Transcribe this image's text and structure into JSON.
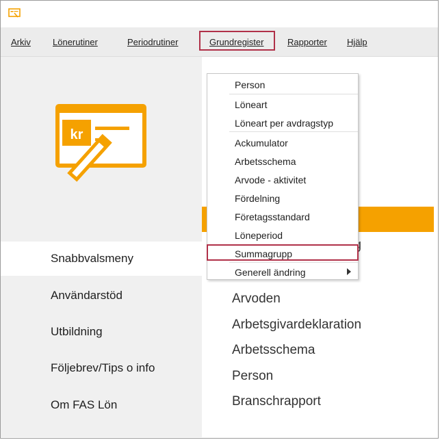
{
  "menubar": {
    "items": [
      {
        "label": "Arkiv",
        "id": "arkiv"
      },
      {
        "label": "Lönerutiner",
        "id": "lonerutiner"
      },
      {
        "label": "Periodrutiner",
        "id": "periodrutiner"
      },
      {
        "label": "Grundregister",
        "id": "grundregister"
      },
      {
        "label": "Rapporter",
        "id": "rapporter"
      },
      {
        "label": "Hjälp",
        "id": "hjalp"
      }
    ],
    "active": "Grundregister"
  },
  "logo": {
    "text": "kr",
    "icon": "invoice-pen-icon"
  },
  "sidebar": {
    "items": [
      {
        "label": "Snabbvalsmeny"
      },
      {
        "label": "Användarstöd"
      },
      {
        "label": "Utbildning"
      },
      {
        "label": "Följebrev/Tips o info"
      },
      {
        "label": "Om FAS Lön"
      }
    ],
    "active": "Snabbvalsmeny"
  },
  "dropdown": {
    "items": [
      {
        "label": "Person"
      },
      {
        "label": "Löneart"
      },
      {
        "label": "Löneart per avdragstyp"
      },
      {
        "label": "Ackumulator"
      },
      {
        "label": "Arbetsschema"
      },
      {
        "label": "Arvode - aktivitet"
      },
      {
        "label": "Fördelning"
      },
      {
        "label": "Företagsstandard"
      },
      {
        "label": "Löneperiod"
      },
      {
        "label": "Summagrupp"
      },
      {
        "label": "Generell ändring"
      }
    ],
    "highlighted": "Summagrupp",
    "submenu_item": "Generell ändring"
  },
  "main": {
    "partial_text": "g",
    "links": [
      {
        "label": "Arvoden"
      },
      {
        "label": "Arbetsgivardeklaration"
      },
      {
        "label": "Arbetsschema"
      },
      {
        "label": "Person"
      },
      {
        "label": "Branschrapport"
      }
    ]
  },
  "colors": {
    "accent": "#f5a100",
    "highlight_border": "#b03048",
    "sidebar_bg": "#f0f0f0",
    "menubar_bg": "#ececec"
  }
}
